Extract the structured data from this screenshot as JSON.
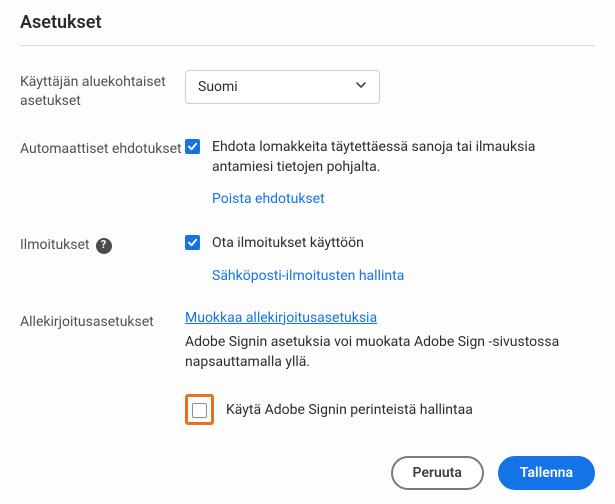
{
  "title": "Asetukset",
  "locale": {
    "label": "Käyttäjän aluekohtaiset asetukset",
    "selected": "Suomi"
  },
  "auto_suggest": {
    "label": "Automaattiset ehdotukset",
    "checkbox_text": "Ehdota lomakkeita täytettäessä sanoja tai ilmauksia antamiesi tietojen pohjalta.",
    "link": "Poista ehdotukset",
    "checked": true
  },
  "notifications": {
    "label": "Ilmoitukset",
    "checkbox_text": "Ota ilmoitukset käyttöön",
    "link": "Sähköposti-ilmoitusten hallinta",
    "checked": true
  },
  "signing": {
    "label": "Allekirjoitusasetukset",
    "edit_link": "Muokkaa allekirjoitusasetuksia",
    "description": "Adobe Signin asetuksia voi muokata Adobe Sign -sivustossa napsauttamalla yllä.",
    "legacy_checkbox": "Käytä Adobe Signin perinteistä hallintaa",
    "legacy_checked": false
  },
  "buttons": {
    "cancel": "Peruuta",
    "save": "Tallenna"
  }
}
